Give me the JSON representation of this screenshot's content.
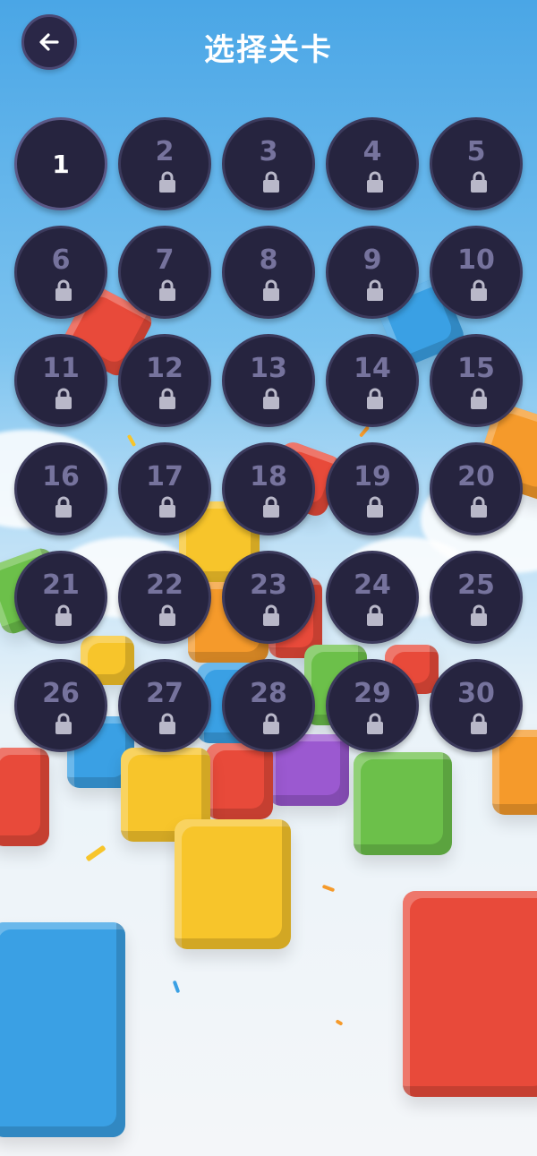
{
  "header": {
    "title": "选择关卡",
    "back_icon": "arrow-left-icon"
  },
  "levels": [
    {
      "number": "1",
      "locked": false
    },
    {
      "number": "2",
      "locked": true
    },
    {
      "number": "3",
      "locked": true
    },
    {
      "number": "4",
      "locked": true
    },
    {
      "number": "5",
      "locked": true
    },
    {
      "number": "6",
      "locked": true
    },
    {
      "number": "7",
      "locked": true
    },
    {
      "number": "8",
      "locked": true
    },
    {
      "number": "9",
      "locked": true
    },
    {
      "number": "10",
      "locked": true
    },
    {
      "number": "11",
      "locked": true
    },
    {
      "number": "12",
      "locked": true
    },
    {
      "number": "13",
      "locked": true
    },
    {
      "number": "14",
      "locked": true
    },
    {
      "number": "15",
      "locked": true
    },
    {
      "number": "16",
      "locked": true
    },
    {
      "number": "17",
      "locked": true
    },
    {
      "number": "18",
      "locked": true
    },
    {
      "number": "19",
      "locked": true
    },
    {
      "number": "20",
      "locked": true
    },
    {
      "number": "21",
      "locked": true
    },
    {
      "number": "22",
      "locked": true
    },
    {
      "number": "23",
      "locked": true
    },
    {
      "number": "24",
      "locked": true
    },
    {
      "number": "25",
      "locked": true
    },
    {
      "number": "26",
      "locked": true
    },
    {
      "number": "27",
      "locked": true
    },
    {
      "number": "28",
      "locked": true
    },
    {
      "number": "29",
      "locked": true
    },
    {
      "number": "30",
      "locked": true
    }
  ],
  "colors": {
    "button_bg": "#26243f",
    "locked_text": "#76739d",
    "lock_icon": "#b9b8c9",
    "unlocked_text": "#ffffff"
  }
}
